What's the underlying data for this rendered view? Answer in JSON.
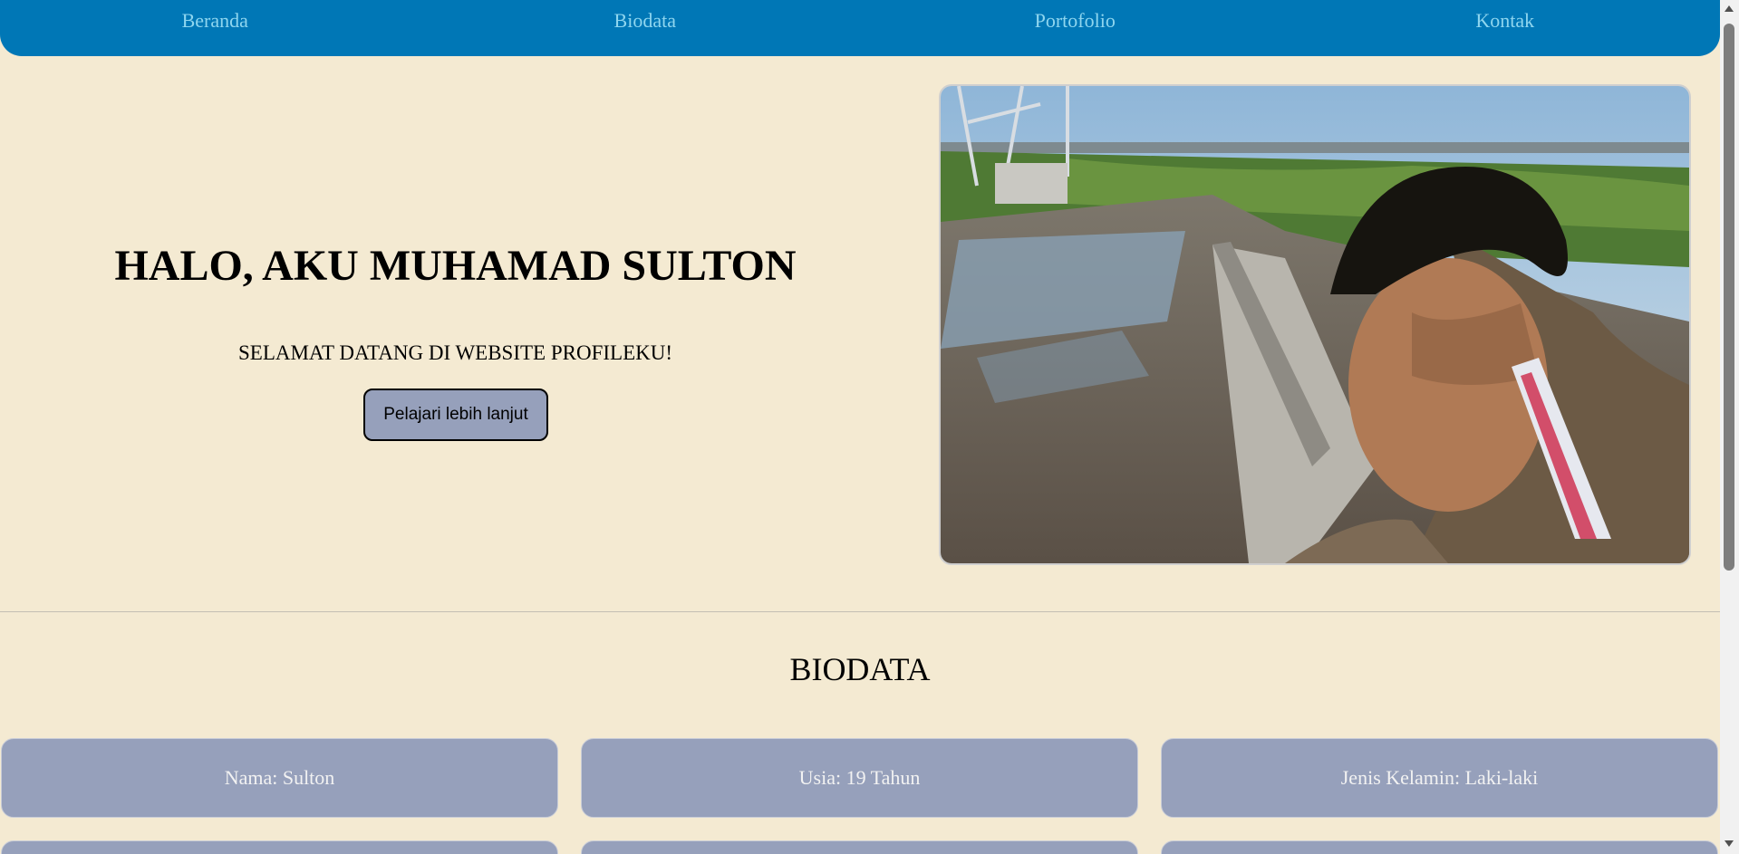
{
  "nav": {
    "items": [
      "Beranda",
      "Biodata",
      "Portofolio",
      "Kontak"
    ]
  },
  "hero": {
    "title": "HALO, AKU MUHAMAD SULTON",
    "subtitle": "SELAMAT DATANG DI WEBSITE PROFILEKU!",
    "button_label": "Pelajari lebih lanjut"
  },
  "biodata": {
    "title": "BIODATA",
    "cards": [
      "Nama: Sulton",
      "Usia: 19 Tahun",
      "Jenis Kelamin: Laki-laki"
    ]
  },
  "colors": {
    "background": "#f4ead2",
    "nav": "#0077b6",
    "nav_text": "#8fd6ef",
    "card": "#96a0bb"
  }
}
